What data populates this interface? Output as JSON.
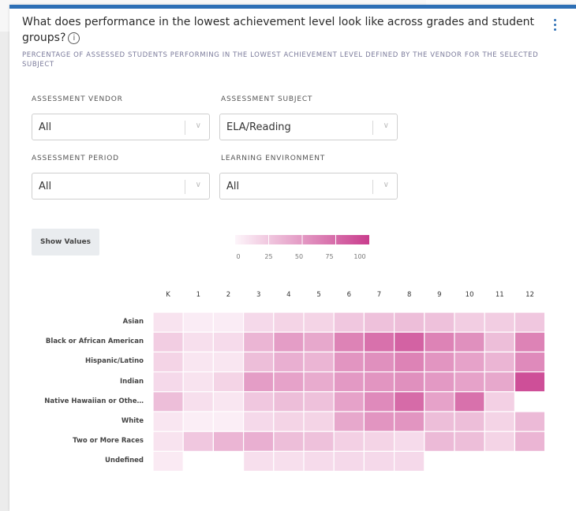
{
  "header": {
    "title": "What does performance in the lowest achievement level look like across grades and student groups?",
    "info_icon": "info-icon",
    "menu_icon": "kebab-menu-icon",
    "subtitle": "PERCENTAGE OF ASSESSED STUDENTS PERFORMING IN THE LOWEST ACHIEVEMENT LEVEL DEFINED BY THE VENDOR FOR THE SELECTED SUBJECT"
  },
  "filters": {
    "vendor": {
      "label": "ASSESSMENT VENDOR",
      "value": "All"
    },
    "subject": {
      "label": "ASSESSMENT SUBJECT",
      "value": "ELA/Reading"
    },
    "period": {
      "label": "ASSESSMENT PERIOD",
      "value": "All"
    },
    "environment": {
      "label": "LEARNING ENVIRONMENT",
      "value": "All"
    }
  },
  "controls": {
    "show_values_label": "Show Values"
  },
  "legend": {
    "ticks": [
      "0",
      "25",
      "50",
      "75",
      "100"
    ],
    "low_color": "#fdf5fa",
    "high_color": "#c93d8d"
  },
  "chart_data": {
    "type": "heatmap",
    "columns": [
      "K",
      "1",
      "2",
      "3",
      "4",
      "5",
      "6",
      "7",
      "8",
      "9",
      "10",
      "11",
      "12"
    ],
    "rows": [
      "Asian",
      "Black or African American",
      "Hispanic/Latino",
      "Indian",
      "Native Hawaiian or Othe…",
      "White",
      "Two or More Races",
      "Undefined"
    ],
    "values": [
      [
        10,
        5,
        5,
        15,
        18,
        18,
        25,
        28,
        30,
        28,
        22,
        22,
        25
      ],
      [
        22,
        12,
        14,
        35,
        48,
        42,
        62,
        72,
        80,
        62,
        55,
        30,
        62
      ],
      [
        18,
        8,
        8,
        30,
        38,
        35,
        52,
        55,
        62,
        52,
        45,
        35,
        58
      ],
      [
        15,
        10,
        18,
        48,
        45,
        40,
        50,
        52,
        55,
        50,
        45,
        42,
        90
      ],
      [
        30,
        12,
        8,
        25,
        30,
        28,
        45,
        58,
        75,
        45,
        72,
        20,
        null
      ],
      [
        8,
        4,
        4,
        15,
        18,
        18,
        42,
        52,
        52,
        30,
        30,
        18,
        32
      ],
      [
        10,
        25,
        35,
        38,
        30,
        28,
        20,
        18,
        14,
        32,
        30,
        18,
        35
      ],
      [
        6,
        null,
        null,
        12,
        12,
        14,
        15,
        15,
        15,
        null,
        null,
        null,
        null
      ]
    ],
    "value_range": [
      0,
      100
    ]
  }
}
